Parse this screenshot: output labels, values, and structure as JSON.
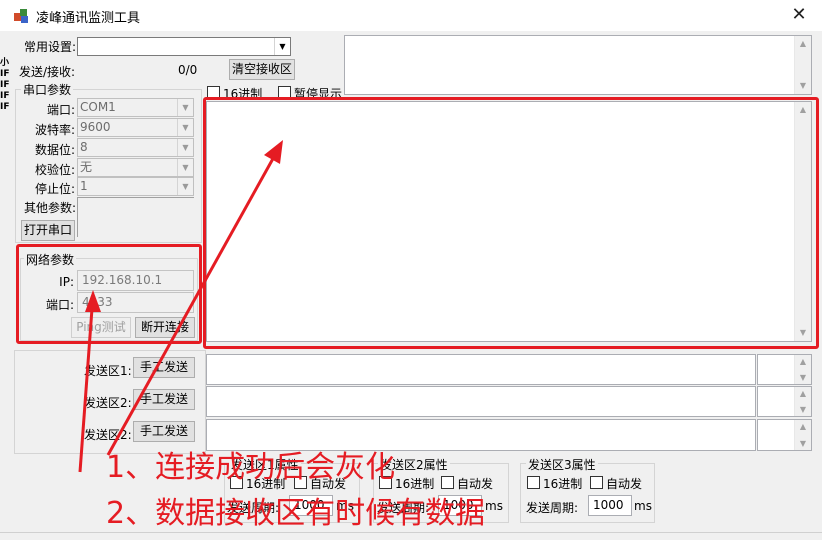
{
  "window": {
    "title": "凌峰通讯监测工具",
    "close_glyph": "✕"
  },
  "top": {
    "preset_label": "常用设置:",
    "preset_value": "",
    "txrx_label": "发送/接收:",
    "txrx_count": "0/0",
    "clear_button": "清空接收区",
    "hex_label": "16进制",
    "pause_label": "暂停显示"
  },
  "serial": {
    "group_title": "串口参数",
    "port_label": "端口:",
    "port_value": "COM1",
    "baud_label": "波特率:",
    "baud_value": "9600",
    "databits_label": "数据位:",
    "databits_value": "8",
    "parity_label": "校验位:",
    "parity_value": "无",
    "stopbits_label": "停止位:",
    "stopbits_value": "1",
    "other_label": "其他参数:",
    "open_button": "打开串口"
  },
  "network": {
    "group_title": "网络参数",
    "ip_label": "IP:",
    "ip_value": "192.168.10.1",
    "port_label": "端口:",
    "port_value": "4433",
    "ping_button": "Ping测试",
    "disconnect_button": "断开连接"
  },
  "send": {
    "area1_label": "发送区1:",
    "area2_label": "发送区2:",
    "area3_label": "发送区2:",
    "manual_button": "手工发送"
  },
  "props": [
    {
      "title": "发送区1属性",
      "hex": "16进制",
      "auto": "自动发",
      "period_label": "发送周期:",
      "period": "1000",
      "unit": "ms"
    },
    {
      "title": "发送区2属性",
      "hex": "16进制",
      "auto": "自动发",
      "period_label": "发送周期:",
      "period": "1000",
      "unit": "ms"
    },
    {
      "title": "发送区3属性",
      "hex": "16进制",
      "auto": "自动发",
      "period_label": "发送周期:",
      "period": "1000",
      "unit": "ms"
    }
  ],
  "annotations": {
    "line1": "1、连接成功后会灰化",
    "line2": "2、数据接收区有时候有数据"
  },
  "colors": {
    "annotation_red": "#e51c23",
    "window_bg": "#f0f0f0"
  }
}
